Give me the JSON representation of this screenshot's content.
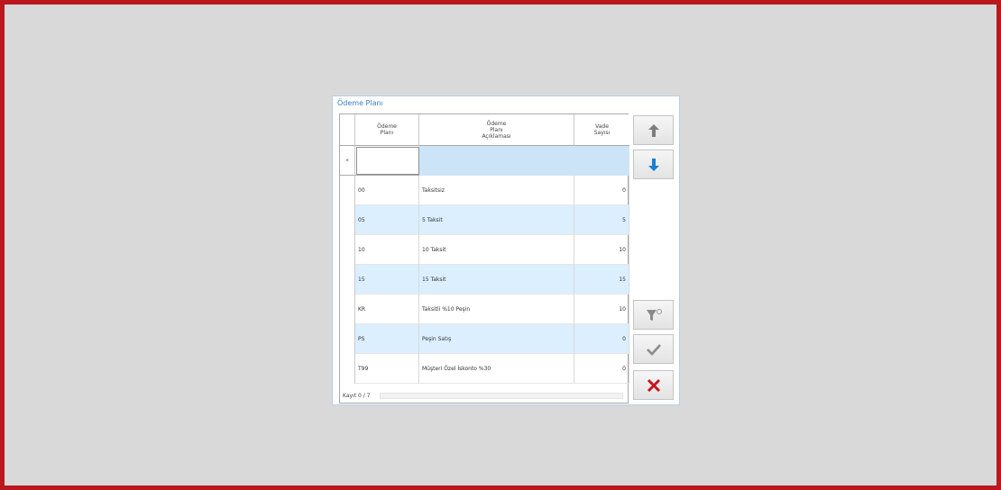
{
  "dialog": {
    "title": "Ödeme Planı"
  },
  "grid": {
    "columns": [
      "Ödeme\nPlanı",
      "Ödeme\nPlanı\nAçıklaması",
      "Vade\nSayısı"
    ],
    "new_row_marker": "*",
    "rows": [
      {
        "code": "00",
        "desc": "Taksitsiz",
        "vade": "0"
      },
      {
        "code": "05",
        "desc": "5 Taksit",
        "vade": "5"
      },
      {
        "code": "10",
        "desc": "10 Taksit",
        "vade": "10"
      },
      {
        "code": "15",
        "desc": "15 Taksit",
        "vade": "15"
      },
      {
        "code": "KR",
        "desc": "Taksitli %10 Peşin",
        "vade": "10"
      },
      {
        "code": "PS",
        "desc": "Peşin Satış",
        "vade": "0"
      },
      {
        "code": "T99",
        "desc": "Müşteri Özel İskonto %30",
        "vade": "0"
      }
    ],
    "footer": "Kayıt 0 / 7"
  },
  "buttons": {
    "up_icon": "arrow-up-icon",
    "down_icon": "arrow-down-icon",
    "filter_icon": "filter-clear-icon",
    "ok_icon": "checkmark-icon",
    "cancel_icon": "close-icon"
  },
  "colors": {
    "frame": "#b8181e",
    "background": "#d9d9d9",
    "title": "#3a7dc4",
    "row_alt": "#dcefff",
    "selected_row": "#cce4f7",
    "down_arrow": "#1a7fd1",
    "cancel": "#c8141c"
  }
}
